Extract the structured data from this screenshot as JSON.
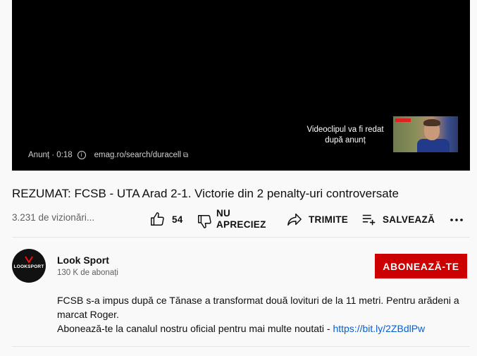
{
  "player": {
    "ad_label": "Anunț · 0:18",
    "ad_url": "emag.ro/search/duracell",
    "next_text": "Videoclipul va fi redat după anunț"
  },
  "video": {
    "title": "REZUMAT: FCSB - UTA Arad 2-1. Victorie din 2 penalty-uri controversate",
    "views": "3.231 de vizionări..."
  },
  "actions": {
    "like_count": "54",
    "dislike_line1": "NU",
    "dislike_line2": "APRECIEZ",
    "share_label": "TRIMITE",
    "save_label": "SALVEAZĂ"
  },
  "channel": {
    "name": "Look Sport",
    "subscribers": "130 K de abonați",
    "avatar_text": "LOOKSPORT",
    "subscribe_label": "ABONEAZĂ-TE"
  },
  "description": {
    "line1": "FCSB s-a impus după ce Tănase a transformat două lovituri de la 11 metri. Pentru arădeni a marcat Roger.",
    "line2_text": "Abonează-te la canalul nostru oficial pentru mai multe noutati - ",
    "line2_link": "https://bit.ly/2ZBdlPw"
  },
  "colors": {
    "subscribe_bg": "#cc0000",
    "link": "#065fd4",
    "secondary_text": "#606060"
  }
}
